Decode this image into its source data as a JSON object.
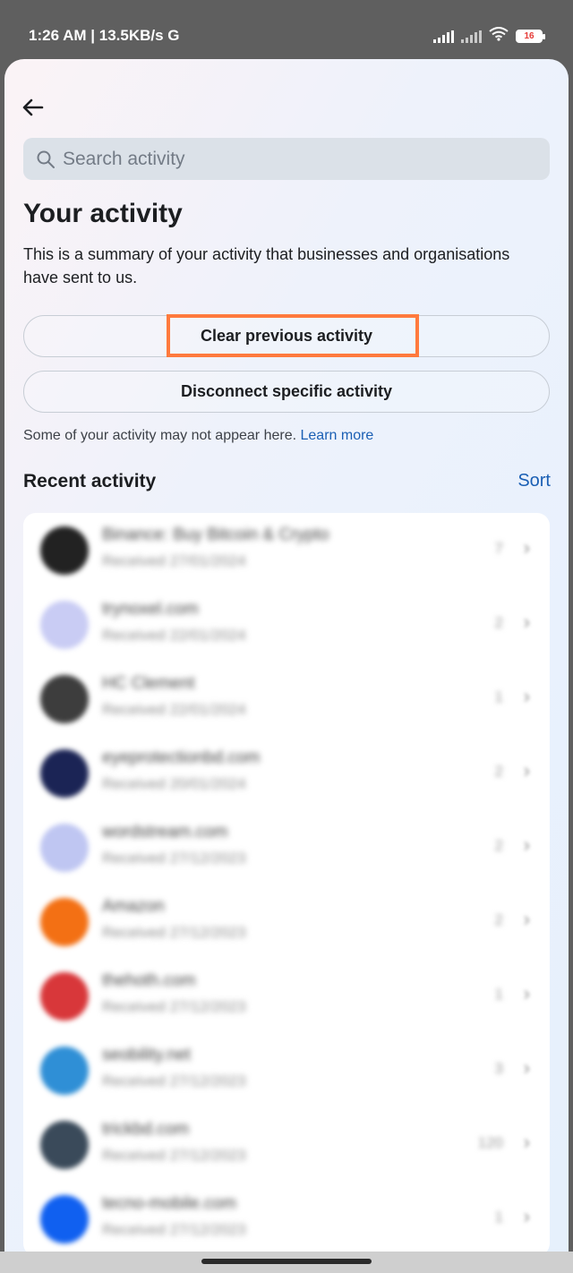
{
  "status_bar": {
    "left_text": "1:26 AM | 13.5KB/s G",
    "battery": "16"
  },
  "search": {
    "placeholder": "Search activity"
  },
  "title": "Your activity",
  "description": "This is a summary of your activity that businesses and organisations have sent to us.",
  "buttons": {
    "clear": "Clear previous activity",
    "disconnect": "Disconnect specific activity"
  },
  "note": {
    "text": "Some of your activity may not appear here.",
    "link": "Learn more"
  },
  "recent": {
    "title": "Recent activity",
    "sort": "Sort"
  },
  "items": [
    {
      "name": "Binance: Buy Bitcoin & Crypto",
      "sub": "Received 27/01/2024",
      "count": "7",
      "color": "#222222"
    },
    {
      "name": "trynoxel.com",
      "sub": "Received 22/01/2024",
      "count": "2",
      "color": "#c9ccf4"
    },
    {
      "name": "HC Clement",
      "sub": "Received 22/01/2024",
      "count": "1",
      "color": "#3d3d3d"
    },
    {
      "name": "eyeprotectionbd.com",
      "sub": "Received 20/01/2024",
      "count": "2",
      "color": "#1b2455"
    },
    {
      "name": "wordstream.com",
      "sub": "Received 27/12/2023",
      "count": "2",
      "color": "#bfc6f2"
    },
    {
      "name": "Amazon",
      "sub": "Received 27/12/2023",
      "count": "2",
      "color": "#f37014"
    },
    {
      "name": "thehoth.com",
      "sub": "Received 27/12/2023",
      "count": "1",
      "color": "#d8373a"
    },
    {
      "name": "seobility.net",
      "sub": "Received 27/12/2023",
      "count": "3",
      "color": "#2f8fd6"
    },
    {
      "name": "trickbd.com",
      "sub": "Received 27/12/2023",
      "count": "120",
      "color": "#3a4a5a"
    },
    {
      "name": "tecno-mobile.com",
      "sub": "Received 27/12/2023",
      "count": "1",
      "color": "#1060f0"
    }
  ]
}
